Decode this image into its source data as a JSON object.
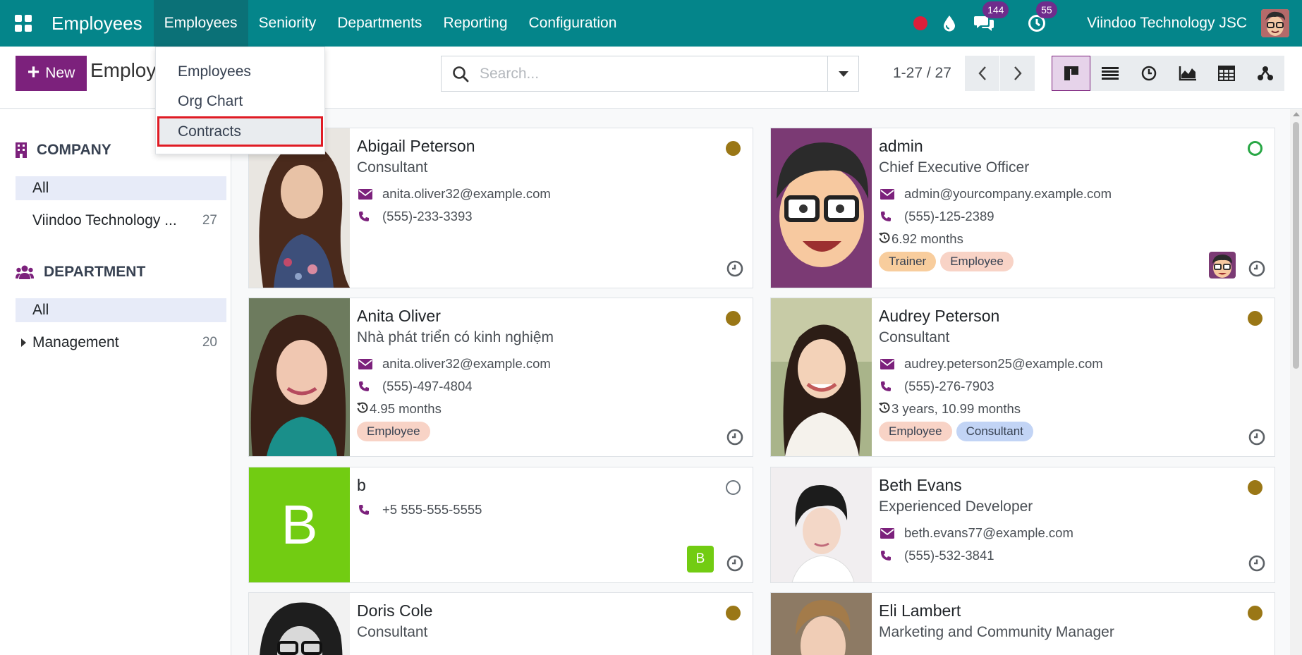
{
  "navbar": {
    "app_name": "Employees",
    "menu": [
      "Employees",
      "Seniority",
      "Departments",
      "Reporting",
      "Configuration"
    ],
    "messages_count": "144",
    "activities_count": "55",
    "company": "Viindoo Technology JSC",
    "color": "#04858a"
  },
  "dropdown": {
    "items": [
      "Employees",
      "Org Chart",
      "Contracts"
    ],
    "highlighted": "Contracts"
  },
  "control": {
    "new_label": "New",
    "breadcrumb": "Employees",
    "search_placeholder": "Search...",
    "pager": "1-27 / 27",
    "views": [
      "kanban-view-icon",
      "list-view-icon",
      "activity-view-icon",
      "graph-view-icon",
      "pivot-view-icon",
      "hierarchy-view-icon"
    ],
    "active_view": "kanban",
    "accent": "#7c217c"
  },
  "sidepanel": {
    "company": {
      "title": "COMPANY",
      "items": [
        {
          "label": "All",
          "count": ""
        },
        {
          "label": "Viindoo Technology ...",
          "count": "27"
        }
      ]
    },
    "department": {
      "title": "DEPARTMENT",
      "items": [
        {
          "label": "All",
          "count": ""
        },
        {
          "label": "Management",
          "count": "20"
        }
      ]
    }
  },
  "employees": [
    {
      "name": "Abigail Peterson",
      "job": "Consultant",
      "email": "anita.oliver32@example.com",
      "phone": "(555)-233-3393",
      "status": "away"
    },
    {
      "name": "admin",
      "job": "Chief Executive Officer",
      "email": "admin@yourcompany.example.com",
      "phone": "(555)-125-2389",
      "seniority": "6.92 months",
      "tags": [
        "Trainer",
        "Employee"
      ],
      "status": "online"
    },
    {
      "name": "Anita Oliver",
      "job": "Nhà phát triển có kinh nghiệm",
      "email": "anita.oliver32@example.com",
      "phone": "(555)-497-4804",
      "seniority": "4.95 months",
      "tags": [
        "Employee"
      ],
      "status": "away"
    },
    {
      "name": "Audrey Peterson",
      "job": "Consultant",
      "email": "audrey.peterson25@example.com",
      "phone": "(555)-276-7903",
      "seniority": "3 years, 10.99 months",
      "tags": [
        "Employee",
        "Consultant"
      ],
      "status": "away"
    },
    {
      "name": "b",
      "phone": "+5 555-555-5555",
      "initial": "B",
      "status": "offline"
    },
    {
      "name": "Beth Evans",
      "job": "Experienced Developer",
      "email": "beth.evans77@example.com",
      "phone": "(555)-532-3841",
      "status": "away"
    },
    {
      "name": "Doris Cole",
      "job": "Consultant",
      "status": "away"
    },
    {
      "name": "Eli Lambert",
      "job": "Marketing and Community Manager",
      "status": "away"
    }
  ],
  "tag_colors": {
    "Trainer": "#f8cd9d",
    "Employee": "#f8d3c6",
    "Consultant": "#c2d4f5"
  }
}
